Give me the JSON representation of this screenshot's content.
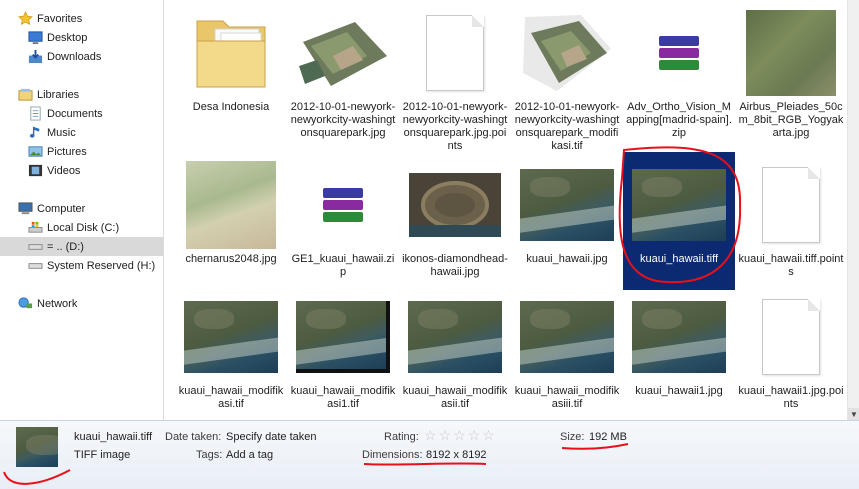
{
  "nav": {
    "favorites": "Favorites",
    "desktop": "Desktop",
    "downloads": "Downloads",
    "libraries": "Libraries",
    "documents": "Documents",
    "music": "Music",
    "pictures": "Pictures",
    "videos": "Videos",
    "computer": "Computer",
    "local_disk": "Local Disk (C:)",
    "d_drive": "= .. (D:)",
    "system_reserved": "System Reserved (H:)",
    "network": "Network"
  },
  "files": [
    {
      "name": "Desa Indonesia",
      "icon": "folder"
    },
    {
      "name": "2012-10-01-newyork-newyorkcity-washingtonsquarepark.jpg",
      "icon": "aerial-image"
    },
    {
      "name": "2012-10-01-newyork-newyorkcity-washingtonsquarepark.jpg.points",
      "icon": "blank-document"
    },
    {
      "name": "2012-10-01-newyork-newyorkcity-washingtonsquarepark_modifikasi.tif",
      "icon": "aerial-image"
    },
    {
      "name": "Adv_Ortho_Vision_Mapping[madrid-spain].zip",
      "icon": "winrar-archive"
    },
    {
      "name": "Airbus_Pleiades_50cm_8bit_RGB_Yogyakarta.jpg",
      "icon": "satellite-image"
    },
    {
      "name": "chernarus2048.jpg",
      "icon": "map-image"
    },
    {
      "name": "GE1_kuaui_hawaii.zip",
      "icon": "winrar-archive"
    },
    {
      "name": "ikonos-diamondhead-hawaii.jpg",
      "icon": "crater-image"
    },
    {
      "name": "kuaui_hawaii.jpg",
      "icon": "satellite-image"
    },
    {
      "name": "kuaui_hawaii.tiff",
      "icon": "satellite-image",
      "selected": true
    },
    {
      "name": "kuaui_hawaii.tiff.points",
      "icon": "blank-document"
    },
    {
      "name": "kuaui_hawaii_modifikasi.tif",
      "icon": "satellite-image"
    },
    {
      "name": "kuaui_hawaii_modifikasi1.tif",
      "icon": "satellite-image"
    },
    {
      "name": "kuaui_hawaii_modifikasii.tif",
      "icon": "satellite-image"
    },
    {
      "name": "kuaui_hawaii_modifikasiii.tif",
      "icon": "satellite-image"
    },
    {
      "name": "kuaui_hawaii1.jpg",
      "icon": "satellite-image"
    },
    {
      "name": "kuaui_hawaii1.jpg.points",
      "icon": "blank-document"
    }
  ],
  "details": {
    "filename": "kuaui_hawaii.tiff",
    "filetype": "TIFF image",
    "date_taken_label": "Date taken:",
    "date_taken_value": "Specify date taken",
    "tags_label": "Tags:",
    "tags_value": "Add a tag",
    "rating_label": "Rating:",
    "dimensions_label": "Dimensions:",
    "dimensions_value": "8192 x 8192",
    "size_label": "Size:",
    "size_value": "192 MB"
  },
  "colors": {
    "selection": "#0b2a72",
    "annotation": "#e8101a"
  }
}
